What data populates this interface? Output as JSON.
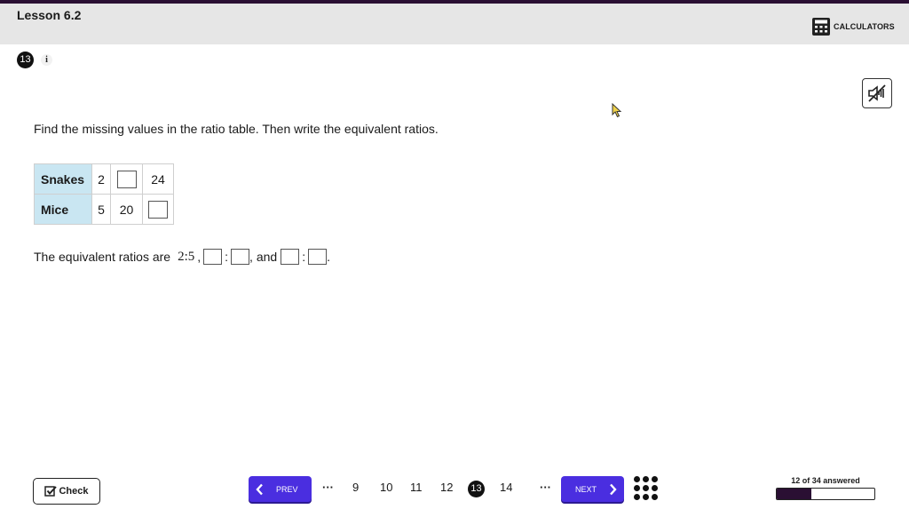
{
  "header": {
    "lesson_title": "Lesson 6.2",
    "calculators_label": "CALCULATORS"
  },
  "question": {
    "number": "13",
    "info_icon_glyph": "i",
    "prompt": "Find the missing values in the ratio table. Then write the equivalent ratios.",
    "table": {
      "rows": [
        {
          "label": "Snakes",
          "cells": [
            "2",
            "",
            "24"
          ]
        },
        {
          "label": "Mice",
          "cells": [
            "5",
            "20",
            ""
          ]
        }
      ]
    },
    "equivalent": {
      "lead": "The equivalent ratios are",
      "given_ratio": "2:5",
      "comma": ",",
      "colon": ":",
      "and_text": ", and",
      "period": "."
    }
  },
  "footer": {
    "check_label": "Check",
    "prev_label": "PREV",
    "next_label": "NEXT",
    "ellipsis": "···",
    "pages": [
      "9",
      "10",
      "11",
      "12",
      "13",
      "14"
    ],
    "current_page": "13",
    "progress_text": "12 of 34 answered",
    "progress_fraction": 0.353
  },
  "icons": {
    "calculator": "calculator-icon",
    "text_to_speech": "speaker-muted-icon",
    "info": "info-icon",
    "check": "checkmark-icon",
    "prev": "chevron-left-icon",
    "next": "chevron-right-icon",
    "grid": "grid-dots-icon"
  },
  "colors": {
    "accent": "#4a2ee0",
    "header_bg": "#e6e6e6",
    "table_head_bg": "#c9e6f2",
    "dark": "#2a0f33"
  }
}
